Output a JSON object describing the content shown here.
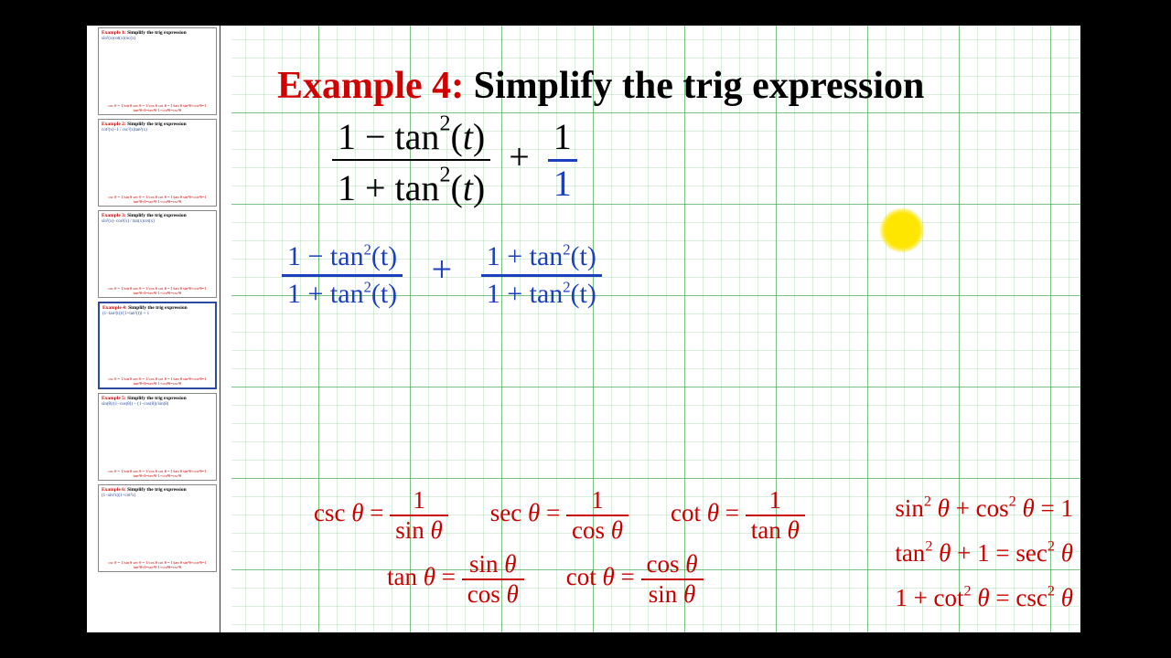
{
  "title": {
    "label": "Example 4:",
    "text": "Simplify the trig expression"
  },
  "thumbs": [
    {
      "hdr": "Example 1:",
      "body": "sin²(x)cot(x)csc(x)",
      "selected": false
    },
    {
      "hdr": "Example 2:",
      "body": "cot²(x)−1 / csc²(x)tan²(x)",
      "selected": false
    },
    {
      "hdr": "Example 3:",
      "body": "sin²(x)−cos²(x) / tan(x)cot(x)",
      "selected": false
    },
    {
      "hdr": "Example 4:",
      "body": "(1−tan²(t))/(1+tan²(t)) + 1",
      "selected": true
    },
    {
      "hdr": "Example 5:",
      "body": "sin(θ)/(1−cos(θ)) − (1−cos(θ))/sin(θ)",
      "selected": false
    },
    {
      "hdr": "Example 6:",
      "body": "(1−sin²x)(1+cot²x)",
      "selected": false
    }
  ],
  "thumb_hdr_suffix": "Simplify the trig expression",
  "thumb_foot": "csc θ = 1/sin θ   sec θ = 1/cos θ   cot θ = 1/tan θ   sin²θ+cos²θ=1   tan²θ+1=sec²θ   1+cot²θ=csc²θ",
  "expr": {
    "f1_num": "1 − tan²(t)",
    "f1_den": "1 + tan²(t)",
    "plus": "+",
    "f2_num": "1",
    "f2_den": "1"
  },
  "hw": {
    "f1_num": "1 − tan²(t)",
    "f1_den": "1 + tan²(t)",
    "plus": "+",
    "f2_num": "1 + tan²(t)",
    "f2_den": "1 + tan²(t)"
  },
  "ids": {
    "row1": {
      "csc": {
        "lhs": "csc θ =",
        "num": "1",
        "den": "sin θ"
      },
      "sec": {
        "lhs": "sec θ =",
        "num": "1",
        "den": "cos θ"
      },
      "cot": {
        "lhs": "cot θ =",
        "num": "1",
        "den": "tan θ"
      }
    },
    "row2": {
      "tan": {
        "lhs": "tan θ =",
        "num": "sin θ",
        "den": "cos θ"
      },
      "cot": {
        "lhs": "cot θ =",
        "num": "cos θ",
        "den": "sin θ"
      }
    },
    "right": {
      "p1": "sin²θ + cos²θ = 1",
      "p2": "tan²θ + 1 = sec²θ",
      "p3": "1 + cot²θ = csc²θ"
    }
  }
}
